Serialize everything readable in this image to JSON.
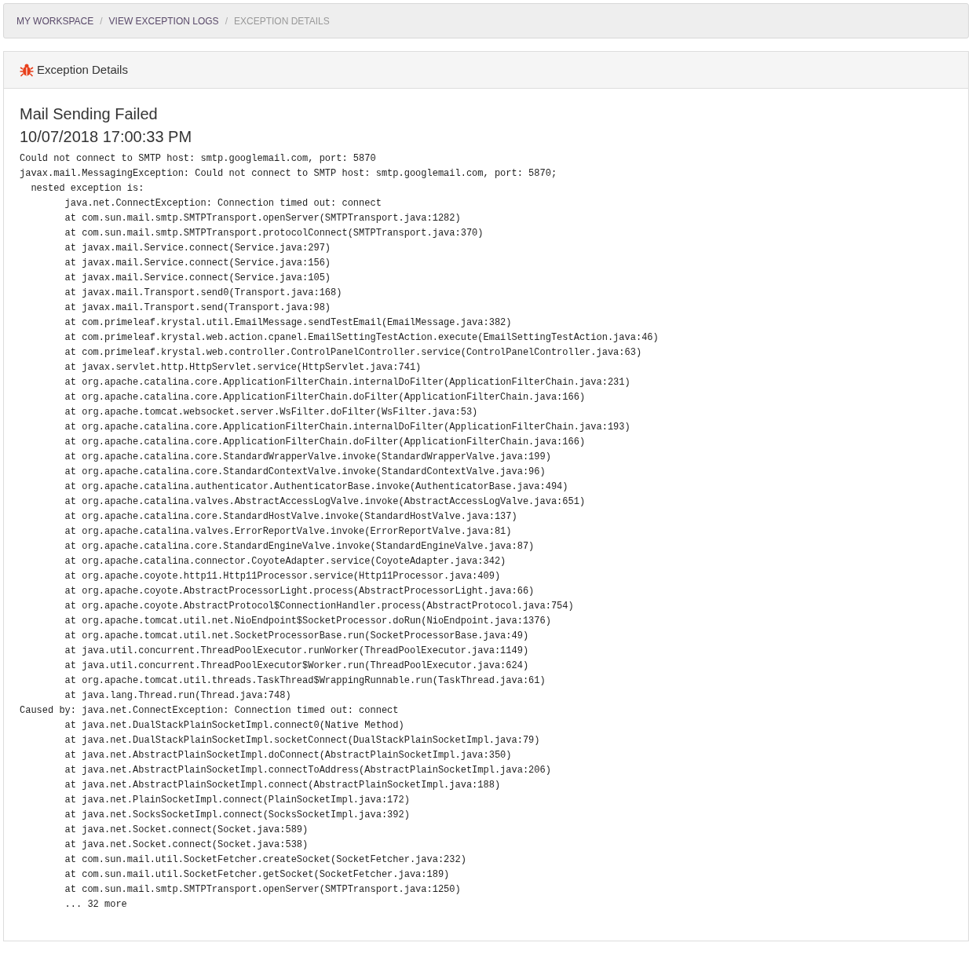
{
  "breadcrumb": [
    {
      "label": "MY WORKSPACE",
      "current": false
    },
    {
      "separator_before": "/",
      "label": "VIEW EXCEPTION LOGS",
      "current": false
    },
    {
      "separator_before": "/",
      "label": "EXCEPTION DETAILS",
      "current": true
    }
  ],
  "panel": {
    "title": "Exception Details"
  },
  "exception": {
    "title": "Mail Sending Failed",
    "timestamp": "10/07/2018 17:00:33 PM",
    "log_lines": [
      "Could not connect to SMTP host: smtp.googlemail.com, port: 5870",
      "javax.mail.MessagingException: Could not connect to SMTP host: smtp.googlemail.com, port: 5870;",
      "  nested exception is:",
      "        java.net.ConnectException: Connection timed out: connect",
      "        at com.sun.mail.smtp.SMTPTransport.openServer(SMTPTransport.java:1282)",
      "        at com.sun.mail.smtp.SMTPTransport.protocolConnect(SMTPTransport.java:370)",
      "        at javax.mail.Service.connect(Service.java:297)",
      "        at javax.mail.Service.connect(Service.java:156)",
      "        at javax.mail.Service.connect(Service.java:105)",
      "        at javax.mail.Transport.send0(Transport.java:168)",
      "        at javax.mail.Transport.send(Transport.java:98)",
      "        at com.primeleaf.krystal.util.EmailMessage.sendTestEmail(EmailMessage.java:382)",
      "        at com.primeleaf.krystal.web.action.cpanel.EmailSettingTestAction.execute(EmailSettingTestAction.java:46)",
      "        at com.primeleaf.krystal.web.controller.ControlPanelController.service(ControlPanelController.java:63)",
      "        at javax.servlet.http.HttpServlet.service(HttpServlet.java:741)",
      "        at org.apache.catalina.core.ApplicationFilterChain.internalDoFilter(ApplicationFilterChain.java:231)",
      "        at org.apache.catalina.core.ApplicationFilterChain.doFilter(ApplicationFilterChain.java:166)",
      "        at org.apache.tomcat.websocket.server.WsFilter.doFilter(WsFilter.java:53)",
      "        at org.apache.catalina.core.ApplicationFilterChain.internalDoFilter(ApplicationFilterChain.java:193)",
      "        at org.apache.catalina.core.ApplicationFilterChain.doFilter(ApplicationFilterChain.java:166)",
      "        at org.apache.catalina.core.StandardWrapperValve.invoke(StandardWrapperValve.java:199)",
      "        at org.apache.catalina.core.StandardContextValve.invoke(StandardContextValve.java:96)",
      "        at org.apache.catalina.authenticator.AuthenticatorBase.invoke(AuthenticatorBase.java:494)",
      "        at org.apache.catalina.valves.AbstractAccessLogValve.invoke(AbstractAccessLogValve.java:651)",
      "        at org.apache.catalina.core.StandardHostValve.invoke(StandardHostValve.java:137)",
      "        at org.apache.catalina.valves.ErrorReportValve.invoke(ErrorReportValve.java:81)",
      "        at org.apache.catalina.core.StandardEngineValve.invoke(StandardEngineValve.java:87)",
      "        at org.apache.catalina.connector.CoyoteAdapter.service(CoyoteAdapter.java:342)",
      "        at org.apache.coyote.http11.Http11Processor.service(Http11Processor.java:409)",
      "        at org.apache.coyote.AbstractProcessorLight.process(AbstractProcessorLight.java:66)",
      "        at org.apache.coyote.AbstractProtocol$ConnectionHandler.process(AbstractProtocol.java:754)",
      "        at org.apache.tomcat.util.net.NioEndpoint$SocketProcessor.doRun(NioEndpoint.java:1376)",
      "        at org.apache.tomcat.util.net.SocketProcessorBase.run(SocketProcessorBase.java:49)",
      "        at java.util.concurrent.ThreadPoolExecutor.runWorker(ThreadPoolExecutor.java:1149)",
      "        at java.util.concurrent.ThreadPoolExecutor$Worker.run(ThreadPoolExecutor.java:624)",
      "        at org.apache.tomcat.util.threads.TaskThread$WrappingRunnable.run(TaskThread.java:61)",
      "        at java.lang.Thread.run(Thread.java:748)",
      "Caused by: java.net.ConnectException: Connection timed out: connect",
      "        at java.net.DualStackPlainSocketImpl.connect0(Native Method)",
      "        at java.net.DualStackPlainSocketImpl.socketConnect(DualStackPlainSocketImpl.java:79)",
      "        at java.net.AbstractPlainSocketImpl.doConnect(AbstractPlainSocketImpl.java:350)",
      "        at java.net.AbstractPlainSocketImpl.connectToAddress(AbstractPlainSocketImpl.java:206)",
      "        at java.net.AbstractPlainSocketImpl.connect(AbstractPlainSocketImpl.java:188)",
      "        at java.net.PlainSocketImpl.connect(PlainSocketImpl.java:172)",
      "        at java.net.SocksSocketImpl.connect(SocksSocketImpl.java:392)",
      "        at java.net.Socket.connect(Socket.java:589)",
      "        at java.net.Socket.connect(Socket.java:538)",
      "        at com.sun.mail.util.SocketFetcher.createSocket(SocketFetcher.java:232)",
      "        at com.sun.mail.util.SocketFetcher.getSocket(SocketFetcher.java:189)",
      "        at com.sun.mail.smtp.SMTPTransport.openServer(SMTPTransport.java:1250)",
      "        ... 32 more"
    ]
  }
}
